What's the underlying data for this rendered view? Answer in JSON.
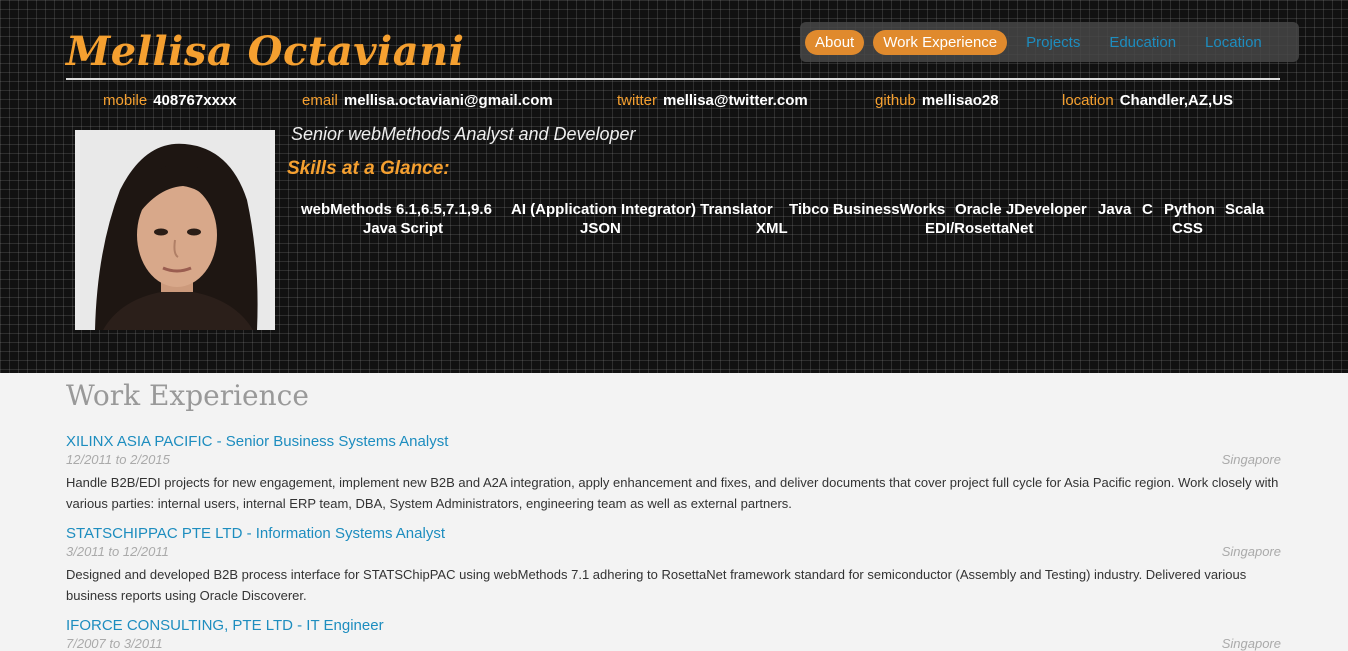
{
  "header": {
    "name": "Mellisa Octaviani",
    "role": "Senior webMethods Analyst and Developer",
    "skills_title": "Skills at a Glance:"
  },
  "nav": {
    "items": [
      {
        "label": "About",
        "active": true
      },
      {
        "label": "Work Experience",
        "active": true
      },
      {
        "label": "Projects",
        "active": false
      },
      {
        "label": "Education",
        "active": false
      },
      {
        "label": "Location",
        "active": false
      }
    ]
  },
  "contacts": [
    {
      "label": "mobile",
      "value": "408767xxxx"
    },
    {
      "label": "email",
      "value": "mellisa.octaviani@gmail.com"
    },
    {
      "label": "twitter",
      "value": "mellisa@twitter.com"
    },
    {
      "label": "github",
      "value": "mellisao28"
    },
    {
      "label": "location",
      "value": "Chandler,AZ,US"
    }
  ],
  "skills": [
    "webMethods 6.1,6.5,7.1,9.6",
    "AI (Application Integrator) Translator",
    "Tibco BusinessWorks",
    "Oracle JDeveloper",
    "Java",
    "C",
    "Python",
    "Scala",
    "Java Script",
    "JSON",
    "XML",
    "EDI/RosettaNet",
    "CSS"
  ],
  "work": {
    "title": "Work Experience",
    "jobs": [
      {
        "title": "XILINX ASIA PACIFIC - Senior Business Systems Analyst",
        "dates": "12/2011 to 2/2015",
        "location": "Singapore",
        "description": "Handle B2B/EDI projects for new engagement, implement new B2B and A2A integration, apply enhancement and fixes, and deliver documents that cover project full cycle for Asia Pacific region. Work closely with various parties: internal users, internal ERP team, DBA, System Administrators, engineering team as well as external partners."
      },
      {
        "title": "STATSCHIPPAC PTE LTD - Information Systems Analyst",
        "dates": "3/2011 to 12/2011",
        "location": "Singapore",
        "description": "Designed and developed B2B process interface for STATSChipPAC using webMethods 7.1 adhering to RosettaNet framework standard for semiconductor (Assembly and Testing) industry. Delivered various business reports using Oracle Discoverer."
      },
      {
        "title": "IFORCE CONSULTING, PTE LTD - IT Engineer",
        "dates": "7/2007 to 3/2011",
        "location": "Singapore",
        "description": ""
      }
    ]
  },
  "colors": {
    "accent": "#f5a030",
    "link": "#1d8dbf",
    "nav_active": "#e08a2d"
  }
}
